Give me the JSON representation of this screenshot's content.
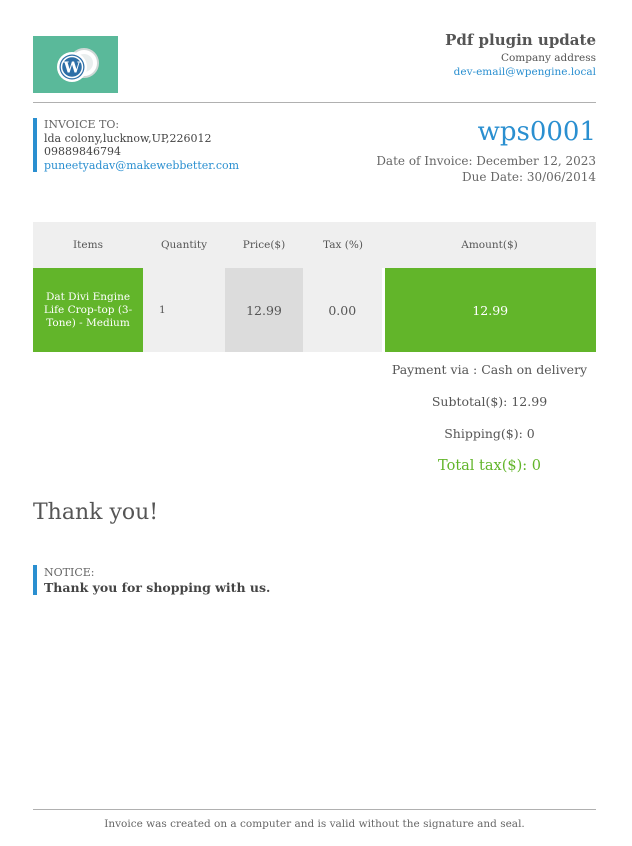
{
  "company": {
    "name": "Pdf plugin update",
    "address": "Company address",
    "email": "dev-email@wpengine.local",
    "logo": "wordpress-logo-icon"
  },
  "bill_to": {
    "label": "INVOICE TO:",
    "address": "lda colony,lucknow,UP,226012",
    "phone": "09889846794",
    "email": "puneetyadav@makewebbetter.com"
  },
  "invoice": {
    "number": "wps0001",
    "date": "Date of Invoice: December 12, 2023",
    "due": "Due Date: 30/06/2014"
  },
  "table": {
    "headers": [
      "Items",
      "Quantity",
      "Price($)",
      "Tax (%)",
      "Amount($)"
    ],
    "rows": [
      {
        "item": "Dat Divi Engine Life Crop-top (3-Tone) - Medium",
        "quantity": "1",
        "price": "12.99",
        "tax": "0.00",
        "amount": "12.99"
      }
    ]
  },
  "totals": {
    "payment": "Payment via : Cash on delivery",
    "subtotal": "Subtotal($): 12.99",
    "shipping": "Shipping($): 0",
    "total_tax": "Total tax($): 0"
  },
  "thanks": "Thank you!",
  "notice": {
    "label": "NOTICE:",
    "message": "Thank you for shopping with us."
  },
  "footer": "Invoice was created on a computer and is valid without the signature and seal.",
  "colors": {
    "accent_blue": "#2a8fd0",
    "accent_green": "#62b52a",
    "logo_bg": "#5ab99a"
  }
}
